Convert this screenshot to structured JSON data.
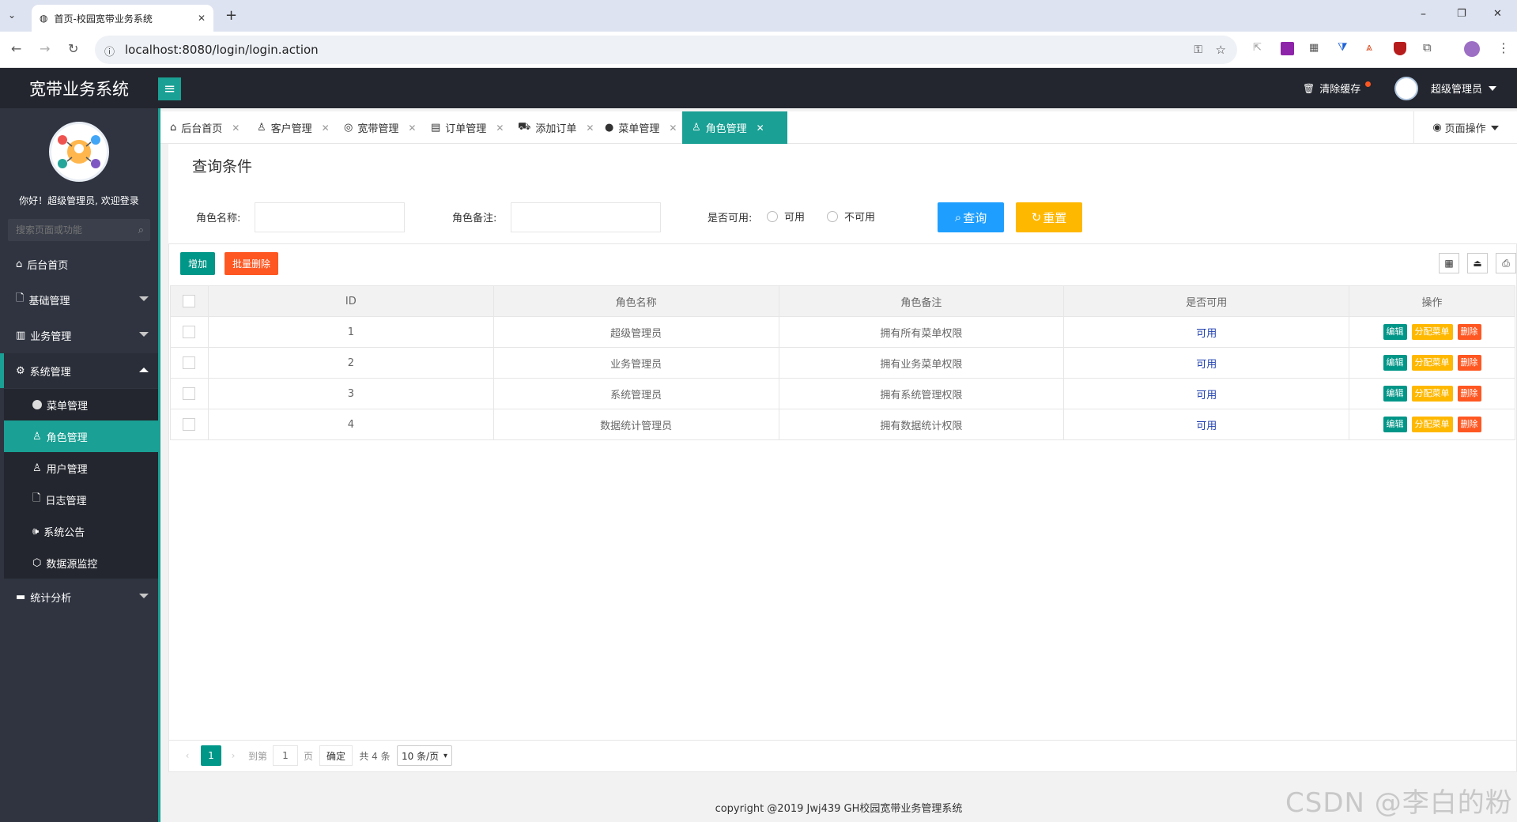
{
  "browser": {
    "tab_title": "首页-校园宽带业务系统",
    "new_tab": "+",
    "url": "localhost:8080/login/login.action",
    "window_controls": [
      "–",
      "❐",
      "✕"
    ]
  },
  "header": {
    "app_title": "宽带业务系统",
    "menu_toggle": "≡",
    "clear_cache": "清除缓存",
    "user_name": "超级管理员",
    "colors": {
      "header_bg": "#23262e",
      "accent": "#1aa094"
    }
  },
  "sidebar": {
    "welcome": "你好！超级管理员, 欢迎登录",
    "search_placeholder": "搜索页面或功能",
    "items": [
      {
        "label": "后台首页",
        "icon": "home-icon"
      },
      {
        "label": "基础管理",
        "icon": "file-icon"
      },
      {
        "label": "业务管理",
        "icon": "building-icon"
      },
      {
        "label": "系统管理",
        "icon": "gear-icon"
      }
    ],
    "sub_items": [
      {
        "label": "菜单管理",
        "icon": "circle-icon"
      },
      {
        "label": "角色管理",
        "icon": "user-icon"
      },
      {
        "label": "用户管理",
        "icon": "user-icon"
      },
      {
        "label": "日志管理",
        "icon": "doc-icon"
      },
      {
        "label": "系统公告",
        "icon": "speaker-icon"
      },
      {
        "label": "数据源监控",
        "icon": "cube-icon"
      }
    ],
    "last_item": {
      "label": "统计分析",
      "icon": "chat-icon"
    }
  },
  "page_tabs": [
    {
      "label": "后台首页",
      "icon": "⌂"
    },
    {
      "label": "客户管理",
      "icon": "♙"
    },
    {
      "label": "宽带管理",
      "icon": "◎"
    },
    {
      "label": "订单管理",
      "icon": "▤"
    },
    {
      "label": "添加订单",
      "icon": "⛟"
    },
    {
      "label": "菜单管理",
      "icon": "●"
    },
    {
      "label": "角色管理",
      "icon": "♙"
    }
  ],
  "page_ops": "页面操作",
  "query": {
    "legend": "查询条件",
    "role_name_label": "角色名称:",
    "role_remark_label": "角色备注:",
    "available_label": "是否可用:",
    "opt_yes": "可用",
    "opt_no": "不可用",
    "search_btn": "查询",
    "reset_btn": "重置"
  },
  "table_toolbar": {
    "add": "增加",
    "batch_delete": "批量删除"
  },
  "table": {
    "columns": [
      "ID",
      "角色名称",
      "角色备注",
      "是否可用",
      "操作"
    ],
    "rows": [
      {
        "id": "1",
        "name": "超级管理员",
        "remark": "拥有所有菜单权限",
        "available": "可用"
      },
      {
        "id": "2",
        "name": "业务管理员",
        "remark": "拥有业务菜单权限",
        "available": "可用"
      },
      {
        "id": "3",
        "name": "系统管理员",
        "remark": "拥有系统管理权限",
        "available": "可用"
      },
      {
        "id": "4",
        "name": "数据统计管理员",
        "remark": "拥有数据统计权限",
        "available": "可用"
      }
    ],
    "actions": {
      "edit": "编辑",
      "assign_menu": "分配菜单",
      "delete": "删除"
    }
  },
  "pagination": {
    "current_page": "1",
    "goto_label": "到第",
    "goto_value": "1",
    "page_suffix": "页",
    "confirm": "确定",
    "total": "共 4 条",
    "page_size": "10 条/页"
  },
  "footer": "copyright @2019 Jwj439 GH校园宽带业务管理系统",
  "watermark": "CSDN @李白的粉"
}
